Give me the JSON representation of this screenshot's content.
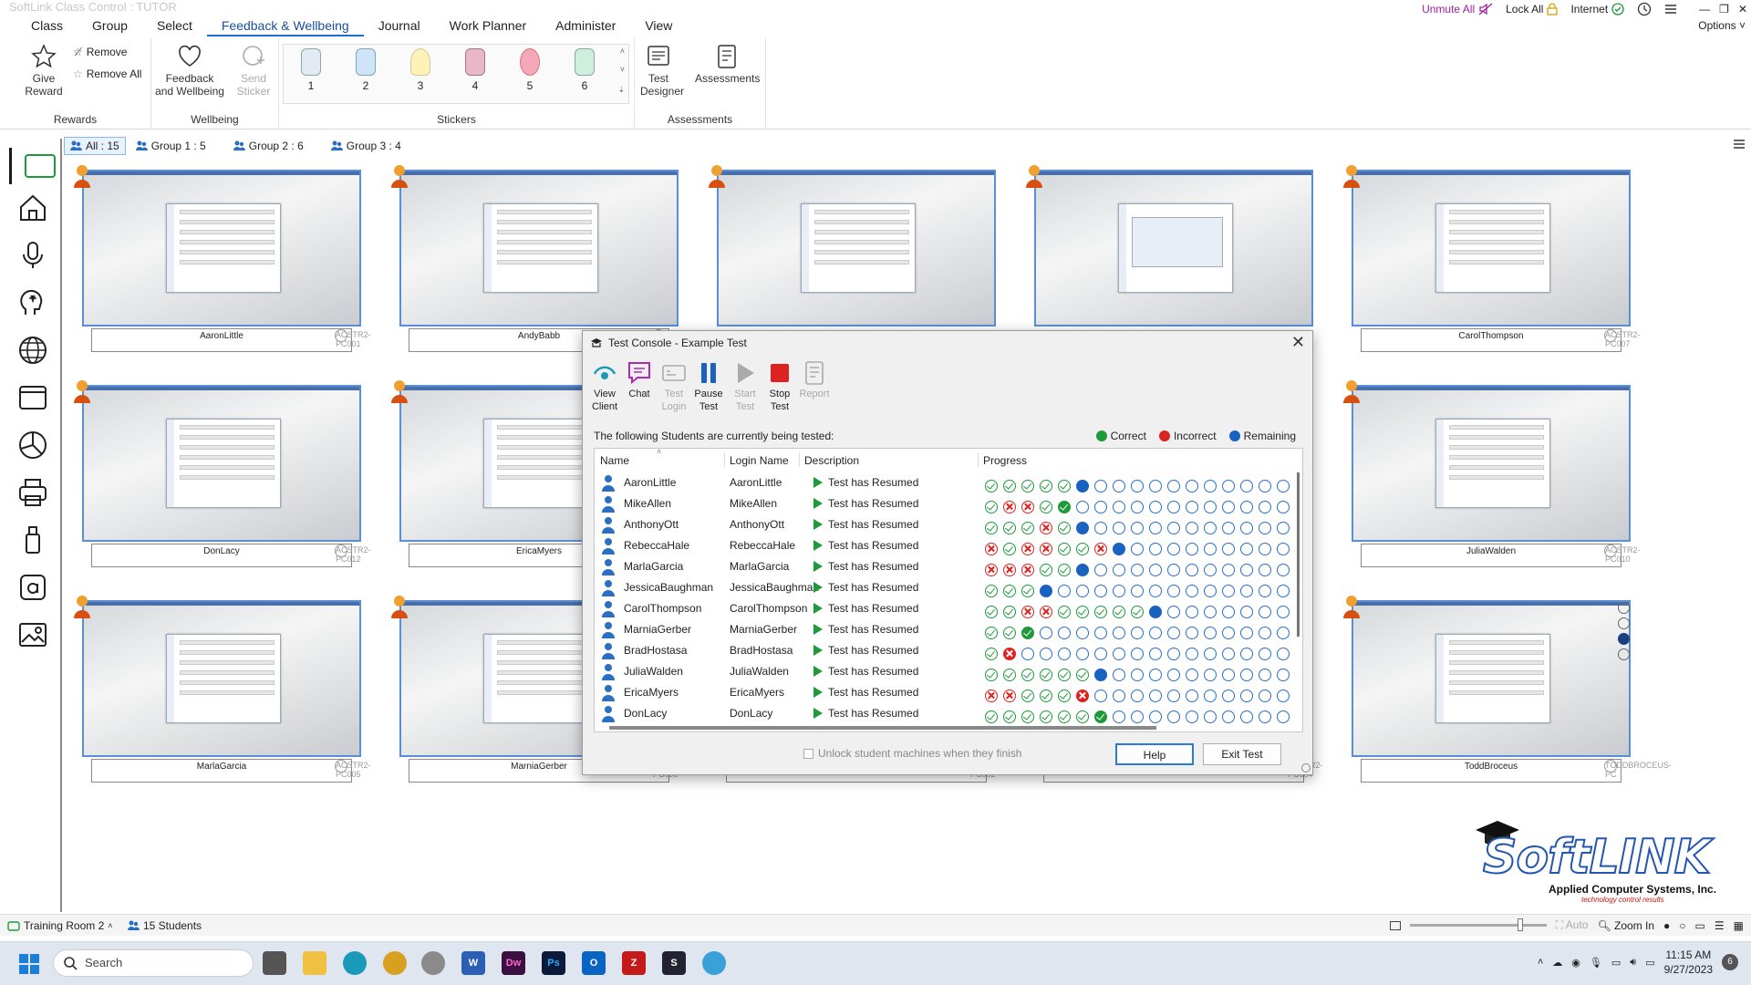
{
  "window": {
    "title": "SoftLink Class Control : TUTOR",
    "unmute_all": "Unmute All",
    "lock_all": "Lock All",
    "internet": "Internet",
    "options": "Options"
  },
  "menu": [
    "Class",
    "Group",
    "Select",
    "Feedback & Wellbeing",
    "Journal",
    "Work Planner",
    "Administer",
    "View"
  ],
  "menu_active_index": 3,
  "ribbon": {
    "give_reward": "Give Reward",
    "remove": "Remove",
    "remove_all": "Remove All",
    "rewards_group": "Rewards",
    "feedback_wellbeing": "Feedback and Wellbeing",
    "send_sticker": "Send Sticker",
    "wellbeing_group": "Wellbeing",
    "stickers": [
      "1",
      "2",
      "3",
      "4",
      "5",
      "6"
    ],
    "stickers_group": "Stickers",
    "test_designer": "Test Designer",
    "assessments": "Assessments",
    "assessments_group": "Assessments"
  },
  "group_tabs": [
    "All : 15",
    "Group 1 : 5",
    "Group 2 : 6",
    "Group 3 : 4"
  ],
  "thumbnails": [
    {
      "name": "AaronLittle",
      "pc": "ACSTR2-PC001"
    },
    {
      "name": "AndyBabb",
      "pc": ""
    },
    {
      "name": "",
      "pc": ""
    },
    {
      "name": "",
      "pc": ""
    },
    {
      "name": "CarolThompson",
      "pc": "ACSTR2-PC007"
    },
    {
      "name": "DonLacy",
      "pc": "ACSTR2-PC012"
    },
    {
      "name": "EricaMyers",
      "pc": ""
    },
    {
      "name": "JuliaWalden",
      "pc": "ACSTR2-PC010"
    },
    {
      "name": "MarlaGarcia",
      "pc": "ACSTR2-PC005"
    },
    {
      "name": "MarniaGerber",
      "pc": "ACSTR2-PC008"
    },
    {
      "name": "",
      "pc": "ACSTR2-PC002"
    },
    {
      "name": "",
      "pc": "ACSTR2-PC004"
    },
    {
      "name": "ToddBroceus",
      "pc": "TODDBROCEUS-PC"
    }
  ],
  "dialog": {
    "title": "Test Console - Example Test",
    "tools": {
      "view_client": "View Client",
      "chat": "Chat",
      "test_login": "Test Login",
      "pause_test": "Pause Test",
      "start_test": "Start Test",
      "stop_test": "Stop Test",
      "report": "Report"
    },
    "info": "The following Students are currently being tested:",
    "legend": {
      "correct": "Correct",
      "incorrect": "Incorrect",
      "remaining": "Remaining"
    },
    "columns": {
      "name": "Name",
      "login": "Login Name",
      "description": "Description",
      "progress": "Progress"
    },
    "rows": [
      {
        "name": "AaronLittle",
        "login": "AaronLittle",
        "desc": "Test has Resumed",
        "progress": "cccccR"
      },
      {
        "name": "MikeAllen",
        "login": "MikeAllen",
        "desc": "Test has Resumed",
        "progress": "cxxcK"
      },
      {
        "name": "AnthonyOtt",
        "login": "AnthonyOtt",
        "desc": "Test has Resumed",
        "progress": "cccxcR"
      },
      {
        "name": "RebeccaHale",
        "login": "RebeccaHale",
        "desc": "Test has Resumed",
        "progress": "xcxxccxR"
      },
      {
        "name": "MarlaGarcia",
        "login": "MarlaGarcia",
        "desc": "Test has Resumed",
        "progress": "xxxccR"
      },
      {
        "name": "JessicaBaughman",
        "login": "JessicaBaughman",
        "desc": "Test has Resumed",
        "progress": "cccR"
      },
      {
        "name": "CarolThompson",
        "login": "CarolThompson",
        "desc": "Test has Resumed",
        "progress": "ccxxcccccR"
      },
      {
        "name": "MarniaGerber",
        "login": "MarniaGerber",
        "desc": "Test has Resumed",
        "progress": "ccK"
      },
      {
        "name": "BradHostasa",
        "login": "BradHostasa",
        "desc": "Test has Resumed",
        "progress": "cX"
      },
      {
        "name": "JuliaWalden",
        "login": "JuliaWalden",
        "desc": "Test has Resumed",
        "progress": "ccccccR"
      },
      {
        "name": "EricaMyers",
        "login": "EricaMyers",
        "desc": "Test has Resumed",
        "progress": "xxcccX"
      },
      {
        "name": "DonLacy",
        "login": "DonLacy",
        "desc": "Test has Resumed",
        "progress": "ccccccK"
      }
    ],
    "unlock_label": "Unlock student machines when they finish",
    "help": "Help",
    "exit": "Exit Test"
  },
  "logo": {
    "brand": "SoftLINK",
    "company": "Applied Computer Systems, Inc.",
    "tagline": "technology control results"
  },
  "statusbar": {
    "room": "Training Room 2",
    "students": "15 Students",
    "auto": "Auto",
    "zoom_in": "Zoom In"
  },
  "taskbar": {
    "search_placeholder": "Search",
    "time": "11:15 AM",
    "date": "9/27/2023",
    "notifications": "6"
  },
  "colors": {
    "accent": "#1a6fd0",
    "correct": "#1e9a3a",
    "incorrect": "#dd2222",
    "remaining": "#1a62c0"
  }
}
